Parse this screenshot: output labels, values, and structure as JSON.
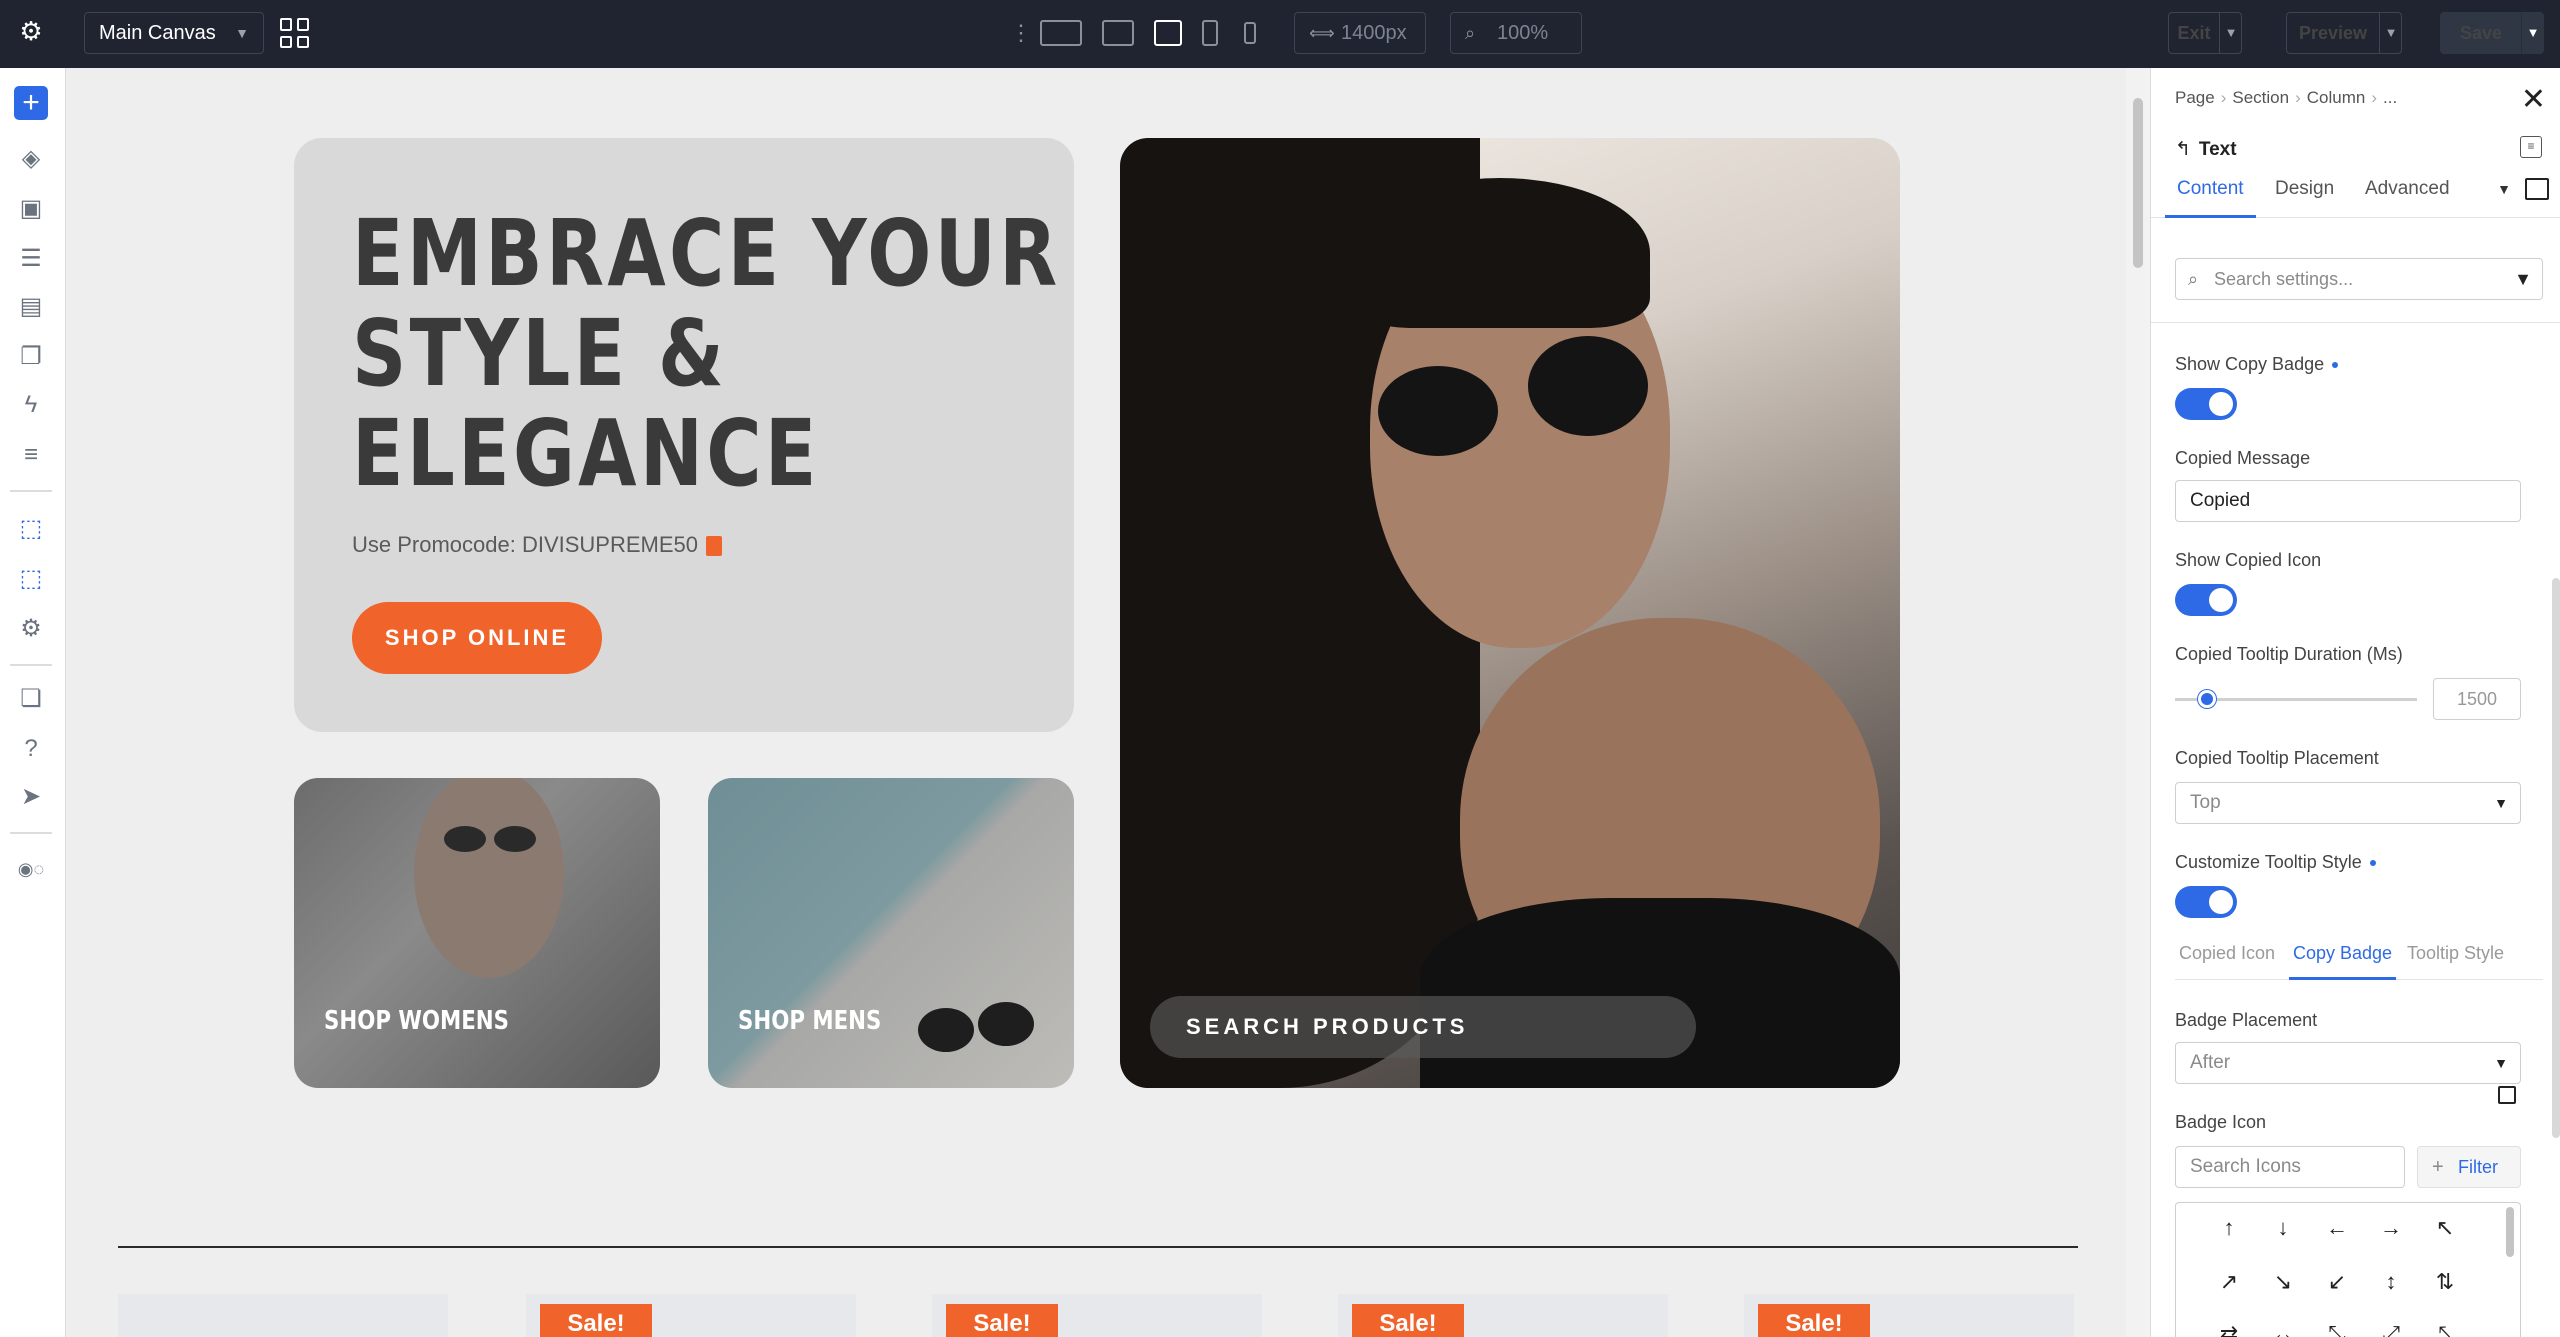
{
  "topbar": {
    "canvas_select": "Main Canvas",
    "width_value": "1400px",
    "zoom_value": "100%",
    "exit_label": "Exit",
    "preview_label": "Preview",
    "save_label": "Save"
  },
  "hero": {
    "title_line1": "EMBRACE YOUR",
    "title_line2": "STYLE &",
    "title_line3": "ELEGANCE",
    "promo_text": "Use Promocode: DIVISUPREME50",
    "shop_button": "SHOP ONLINE",
    "tile_women": "SHOP WOMENS",
    "tile_men": "SHOP MENS",
    "search_products": "SEARCH PRODUCTS"
  },
  "products": {
    "sale_badges": [
      "Sale!",
      "Sale!",
      "Sale!",
      "Sale!"
    ]
  },
  "panel": {
    "breadcrumb": [
      "Page",
      "Section",
      "Column",
      "..."
    ],
    "module_title": "Text",
    "tabs": [
      "Content",
      "Design",
      "Advanced"
    ],
    "active_tab": "Content",
    "search_placeholder": "Search settings...",
    "show_copy_badge_label": "Show Copy Badge",
    "copied_message_label": "Copied Message",
    "copied_message_value": "Copied",
    "show_copied_icon_label": "Show Copied Icon",
    "tooltip_duration_label": "Copied Tooltip Duration (Ms)",
    "tooltip_duration_value": "1500",
    "tooltip_placement_label": "Copied Tooltip Placement",
    "tooltip_placement_value": "Top",
    "customize_tooltip_label": "Customize Tooltip Style",
    "subtabs": [
      "Copied Icon",
      "Copy Badge",
      "Tooltip Style"
    ],
    "active_subtab": "Copy Badge",
    "badge_placement_label": "Badge Placement",
    "badge_placement_value": "After",
    "badge_icon_label": "Badge Icon",
    "search_icons_placeholder": "Search Icons",
    "filter_label": "Filter",
    "icon_glyphs": [
      "↑",
      "↓",
      "←",
      "→",
      "↖",
      "↗",
      "↘",
      "↙",
      "↕",
      "⇅",
      "⇄",
      "↔",
      "⤡",
      "⤢",
      "⤣"
    ]
  },
  "colors": {
    "accent": "#2e6ae6",
    "brand_orange": "#f0632a",
    "topbar": "#1f2430"
  }
}
